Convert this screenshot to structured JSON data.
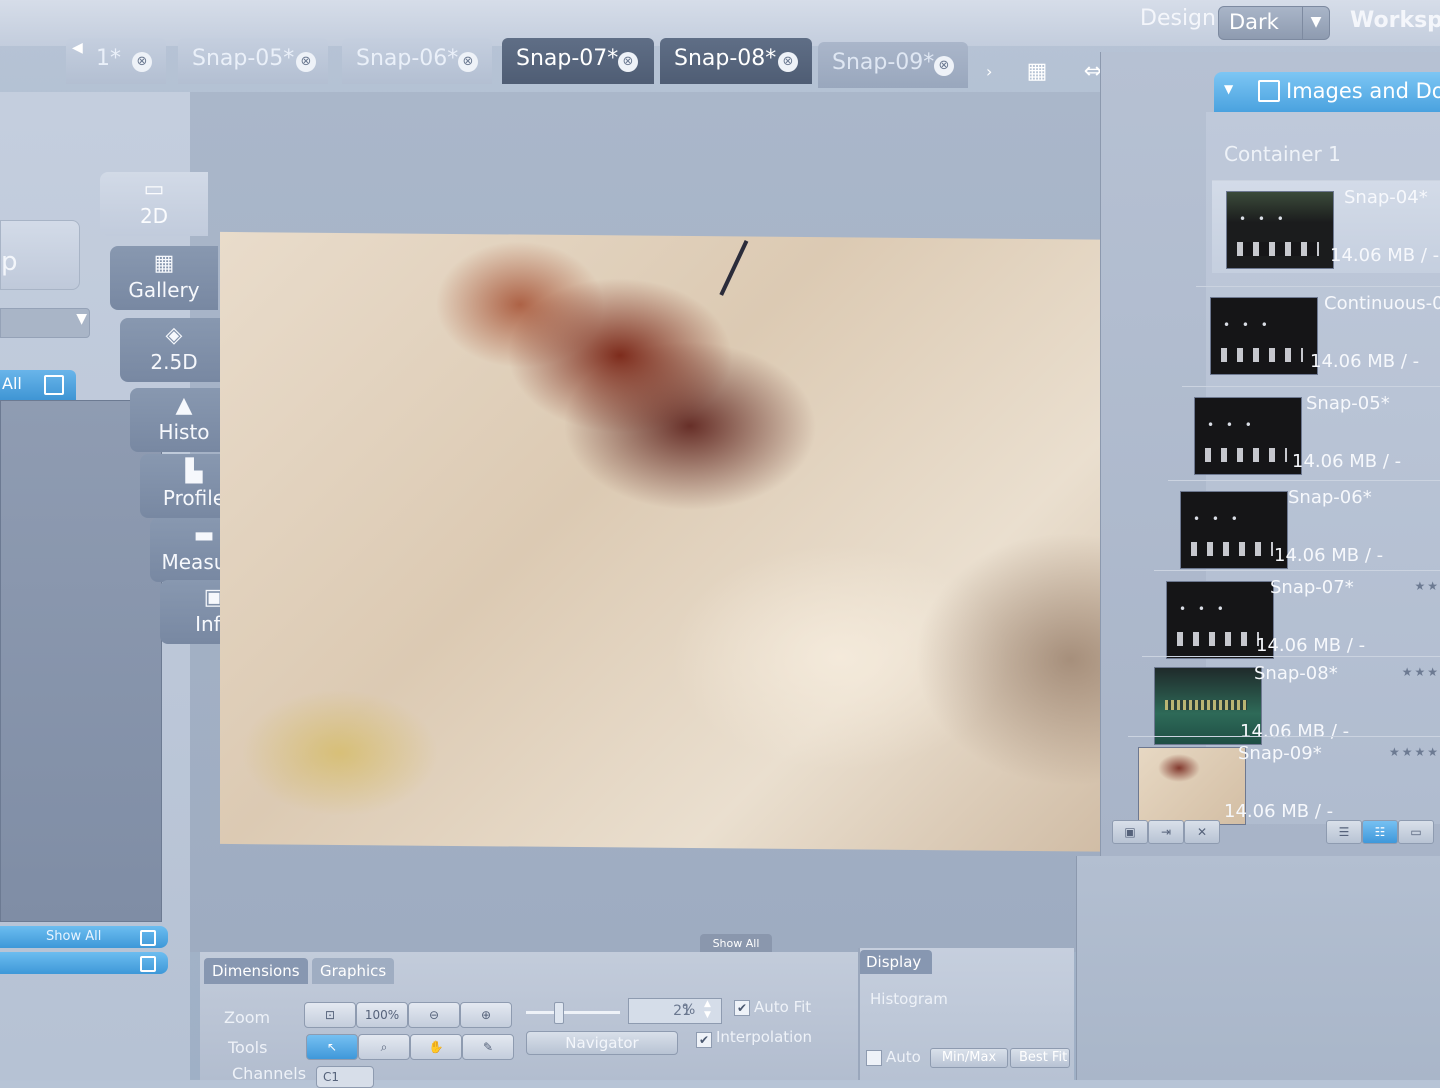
{
  "header": {
    "design_label": "Design",
    "design_value": "Dark",
    "workspace_label": "Workspac"
  },
  "tabs": [
    {
      "label": "1*",
      "close": "⊗"
    },
    {
      "label": "Snap-05*",
      "close": "⊗"
    },
    {
      "label": "Snap-06*",
      "close": "⊗"
    },
    {
      "label": "Snap-07*",
      "close": "⊗"
    },
    {
      "label": "Snap-08*",
      "close": "⊗"
    },
    {
      "label": "Snap-09*",
      "close": "⊗"
    }
  ],
  "toolbar_icons": [
    "split-grid-icon",
    "split-view-icon",
    "settings-gear-icon",
    "chevron-down-icon"
  ],
  "left_panel": {
    "button_fragment": "p",
    "list_header": "All",
    "show_all_label": "Show All"
  },
  "view_modes": [
    {
      "label": "2D",
      "icon": "monitor-icon"
    },
    {
      "label": "Gallery",
      "icon": "grid-icon"
    },
    {
      "label": "2.5D",
      "icon": "surface-icon"
    },
    {
      "label": "Histo",
      "icon": "histogram-icon"
    },
    {
      "label": "Profile",
      "icon": "profile-icon"
    },
    {
      "label": "Measure",
      "icon": "measure-icon"
    },
    {
      "label": "Info",
      "icon": "info-icon"
    }
  ],
  "viewport": {
    "show_all_tab": "Show All"
  },
  "bottom_panel": {
    "tabs": [
      "Dimensions",
      "Graphics"
    ],
    "zoom_label": "Zoom",
    "tools_label": "Tools",
    "channels_label": "Channels",
    "btn_100": "100%",
    "zoom_value": "21",
    "zoom_unit": "%",
    "auto_fit_label": "Auto Fit",
    "auto_fit_checked": true,
    "navigator_label": "Navigator",
    "interpolation_label": "Interpolation",
    "interpolation_checked": true,
    "channel_value": "C1"
  },
  "display_panel": {
    "tab": "Display",
    "histogram_label": "Histogram",
    "auto_label": "Auto",
    "auto_checked": false,
    "minmax_label": "Min/Max",
    "bestfit_label": "Best Fit"
  },
  "right_panel": {
    "header": "Images and Docu",
    "container": "Container 1",
    "documents": [
      {
        "name": "Snap-04*",
        "size": "14.06 MB / -",
        "stars": ""
      },
      {
        "name": "Continuous-0",
        "size": "14.06 MB / -",
        "stars": ""
      },
      {
        "name": "Snap-05*",
        "size": "14.06 MB / -",
        "stars": ""
      },
      {
        "name": "Snap-06*",
        "size": "14.06 MB / -",
        "stars": ""
      },
      {
        "name": "Snap-07*",
        "size": "14.06 MB / -",
        "stars": "★★"
      },
      {
        "name": "Snap-08*",
        "size": "14.06 MB / -",
        "stars": "★★★"
      },
      {
        "name": "Snap-09*",
        "size": "14.06 MB / -",
        "stars": "★★★★"
      }
    ]
  },
  "colors": {
    "accent_blue": "#4aa2df",
    "panel_bg": "#b6c1d3",
    "active_tab": "#4f5d74"
  }
}
